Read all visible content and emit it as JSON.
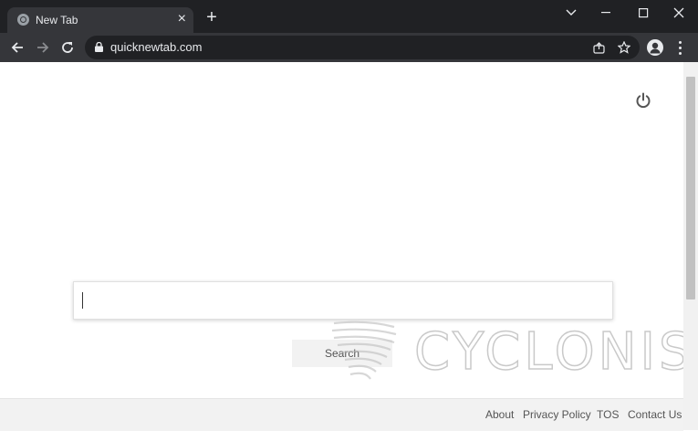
{
  "browser": {
    "tab": {
      "title": "New Tab",
      "favicon": "globe-icon"
    },
    "new_tab_label": "+",
    "window_controls": [
      "chevron-down-icon",
      "minimize-icon",
      "maximize-icon",
      "close-icon"
    ],
    "address_bar": {
      "url": "quicknewtab.com",
      "secure": true
    }
  },
  "page": {
    "search": {
      "value": "",
      "placeholder": ""
    },
    "search_button_label": "Search",
    "watermark_text": "CYCLONIS",
    "footer_links": [
      "About",
      "Privacy Policy",
      "TOS",
      "Contact Us"
    ]
  },
  "colors": {
    "titlebar": "#202124",
    "toolbar": "#35363a",
    "page_bg": "#ffffff",
    "footer_bg": "#f2f2f2"
  }
}
